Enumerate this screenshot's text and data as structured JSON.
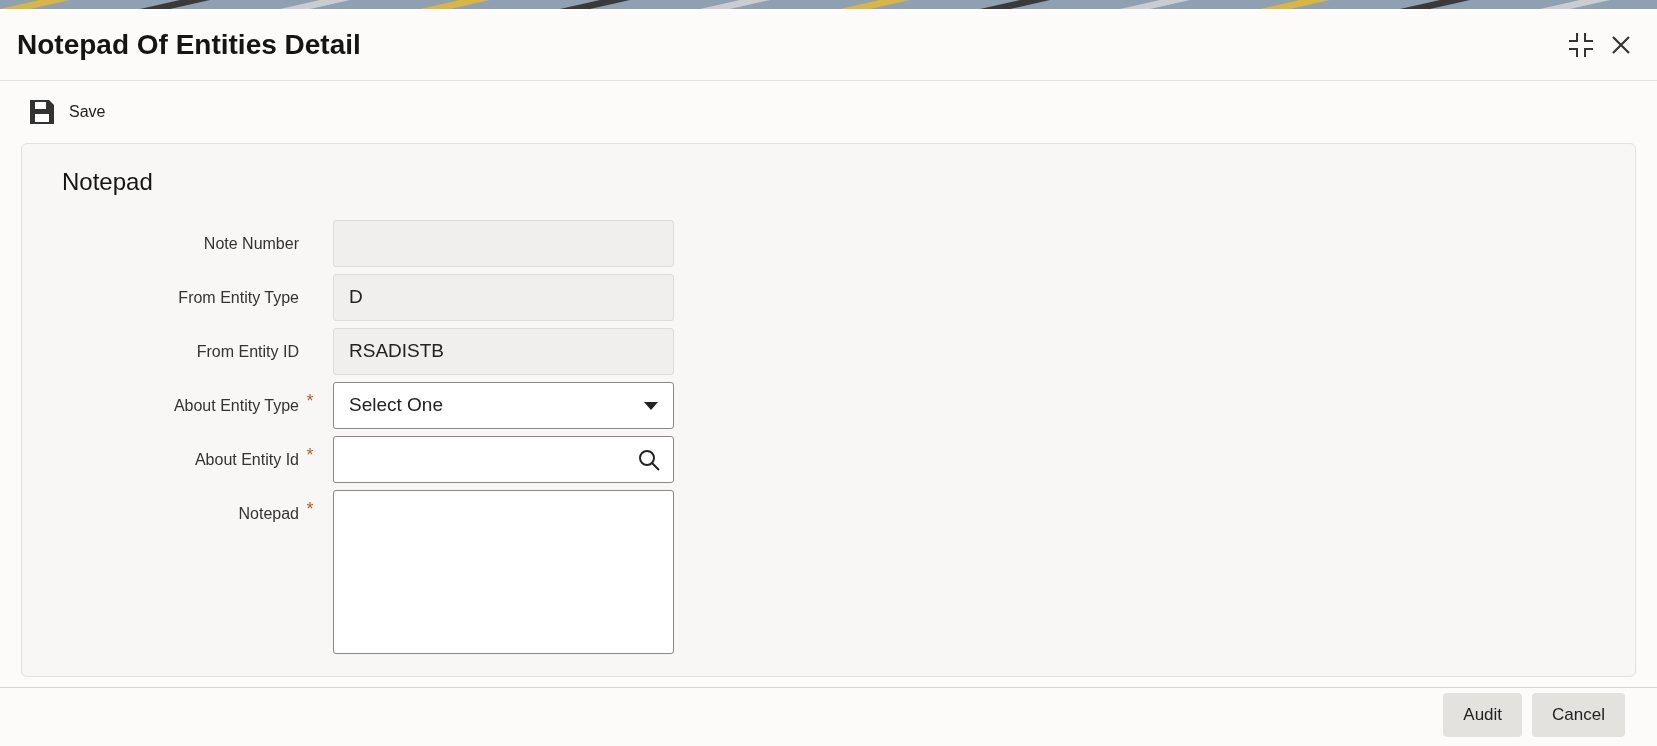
{
  "window": {
    "title": "Notepad Of Entities Detail"
  },
  "toolbar": {
    "save": "Save"
  },
  "section": {
    "title": "Notepad"
  },
  "fields": [
    {
      "label": "Note Number",
      "kind": "text",
      "disabled": true
    },
    {
      "label": "From Entity Type",
      "kind": "text",
      "disabled": true,
      "value": "D"
    },
    {
      "label": "From Entity ID",
      "kind": "text",
      "disabled": true,
      "value": "RSADISTB"
    },
    {
      "label": "About Entity Type",
      "kind": "select",
      "disabled": false,
      "required_mark": "*",
      "value": "Select One"
    },
    {
      "label": "About Entity Id",
      "kind": "search",
      "disabled": false,
      "required_mark": "*"
    },
    {
      "label": "Notepad",
      "kind": "textarea",
      "disabled": false,
      "required_mark": "*"
    }
  ],
  "footer": {
    "buttons": [
      "Audit",
      "Cancel"
    ]
  }
}
